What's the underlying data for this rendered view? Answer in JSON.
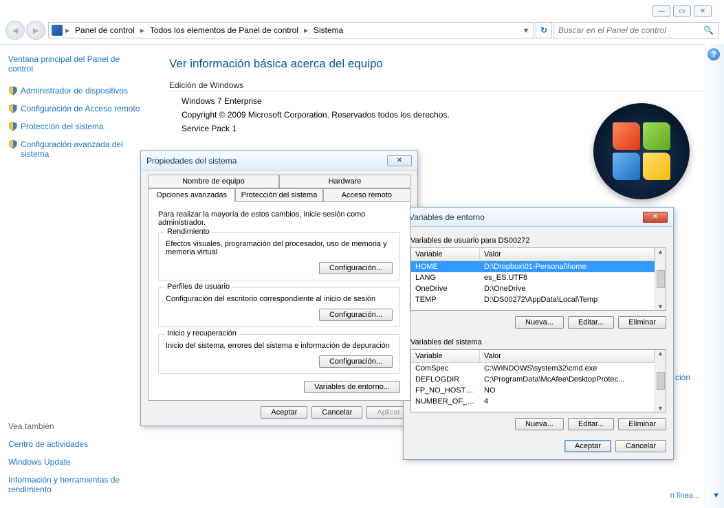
{
  "window_controls": {
    "minimize": "—",
    "maximize": "▭",
    "close": "✕"
  },
  "breadcrumbs": [
    "Panel de control",
    "Todos los elementos de Panel de control",
    "Sistema"
  ],
  "search_placeholder": "Buscar en el Panel de control",
  "sidebar": {
    "title": "Ventana principal del Panel de control",
    "links": [
      "Administrador de dispositivos",
      "Configuración de Acceso remoto",
      "Protección del sistema",
      "Configuración avanzada del sistema"
    ],
    "see_also_label": "Vea también",
    "see_also": [
      "Centro de actividades",
      "Windows Update",
      "Información y herramientas de rendimiento"
    ]
  },
  "main": {
    "title": "Ver información básica acerca del equipo",
    "edition_header": "Edición de Windows",
    "edition_lines": [
      "Windows 7 Enterprise",
      "Copyright © 2009 Microsoft Corporation. Reservados todos los derechos.",
      "Service Pack 1"
    ]
  },
  "prop_dialog": {
    "title": "Propiedades del sistema",
    "close": "✕",
    "tabs_top": [
      "Nombre de equipo",
      "Hardware"
    ],
    "tabs_bottom": [
      "Opciones avanzadas",
      "Protección del sistema",
      "Acceso remoto"
    ],
    "note": "Para realizar la mayoría de estos cambios, inicie sesión como administrador.",
    "groups": [
      {
        "title": "Rendimiento",
        "desc": "Efectos visuales, programación del procesador, uso de memoria y memoria virtual",
        "btn": "Configuración..."
      },
      {
        "title": "Perfiles de usuario",
        "desc": "Configuración del escritorio correspondiente al inicio de sesión",
        "btn": "Configuración..."
      },
      {
        "title": "Inicio y recuperación",
        "desc": "Inicio del sistema, errores del sistema e información de depuración",
        "btn": "Configuración..."
      }
    ],
    "env_btn": "Variables de entorno...",
    "footer": {
      "ok": "Aceptar",
      "cancel": "Cancelar",
      "apply": "Aplicar"
    }
  },
  "env_dialog": {
    "title": "Variables de entorno",
    "close": "✕",
    "user_section_label": "Variables de usuario para DS00272",
    "sys_section_label": "Variables del sistema",
    "col_var": "Variable",
    "col_val": "Valor",
    "user_vars": [
      {
        "name": "HOME",
        "value": "D:\\Dropbox\\01-Personal\\home",
        "selected": true
      },
      {
        "name": "LANG",
        "value": "es_ES.UTF8"
      },
      {
        "name": "OneDrive",
        "value": "D:\\OneDrive"
      },
      {
        "name": "TEMP",
        "value": "D:\\DS00272\\AppData\\Local\\Temp"
      }
    ],
    "sys_vars": [
      {
        "name": "ComSpec",
        "value": "C:\\WINDOWS\\system32\\cmd.exe"
      },
      {
        "name": "DEFLOGDIR",
        "value": "C:\\ProgramData\\McAfee\\DesktopProtec..."
      },
      {
        "name": "FP_NO_HOST_C...",
        "value": "NO"
      },
      {
        "name": "NUMBER_OF_P...",
        "value": "4"
      }
    ],
    "btns": {
      "new": "Nueva...",
      "edit": "Editar...",
      "del": "Eliminar"
    },
    "footer": {
      "ok": "Aceptar",
      "cancel": "Cancelar"
    }
  },
  "partial_links": {
    "cion": "ción",
    "linea": "n línea..."
  }
}
